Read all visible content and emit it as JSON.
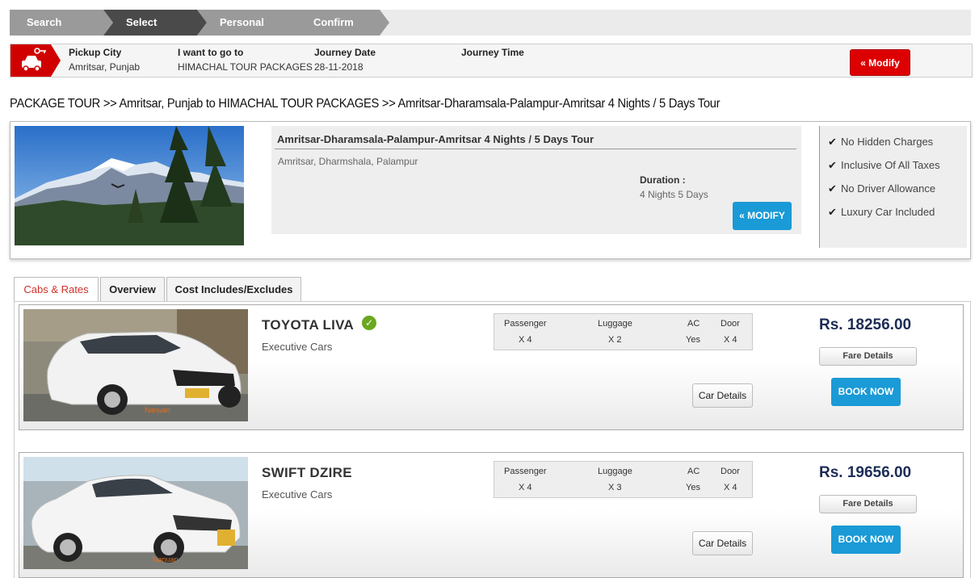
{
  "steps": [
    "Search",
    "Select",
    "Personal",
    "Confirm"
  ],
  "summary": {
    "pickup_label": "Pickup City",
    "pickup_value": "Amritsar, Punjab",
    "goto_label": "I want to go to",
    "goto_value": "HIMACHAL TOUR PACKAGES",
    "date_label": "Journey Date",
    "date_value": "28-11-2018",
    "time_label": "Journey Time",
    "modify_label": "« Modify"
  },
  "breadcrumb": "PACKAGE TOUR >> Amritsar, Punjab to HIMACHAL TOUR PACKAGES  >> Amritsar-Dharamsala-Palampur-Amritsar 4 Nights / 5 Days Tour",
  "package": {
    "title": "Amritsar-Dharamsala-Palampur-Amritsar 4 Nights / 5 Days Tour",
    "cities": "Amritsar, Dharmshala, Palampur",
    "duration_label": "Duration :",
    "duration_value": "4 Nights 5 Days",
    "modify_label": "« MODIFY",
    "features": [
      "No Hidden Charges",
      "Inclusive Of All Taxes",
      "No Driver Allowance",
      "Luxury Car Included"
    ]
  },
  "tabs": [
    "Cabs & Rates",
    "Overview",
    "Cost Includes/Excludes"
  ],
  "spec_labels": {
    "passenger": "Passenger",
    "luggage": "Luggage",
    "ac": "AC",
    "door": "Door"
  },
  "cars": [
    {
      "name": "TOYOTA LIVA",
      "class": "Executive Cars",
      "passenger": "X 4",
      "luggage": "X 2",
      "ac": "Yes",
      "door": "X 4",
      "price": "Rs. 18256.00",
      "fare_label": "Fare Details",
      "book_label": "BOOK NOW",
      "details_label": "Car Details"
    },
    {
      "name": "SWIFT DZIRE",
      "class": "Executive Cars",
      "passenger": "X 4",
      "luggage": "X 3",
      "ac": "Yes",
      "door": "X 4",
      "price": "Rs. 19656.00",
      "fare_label": "Fare Details",
      "book_label": "BOOK NOW",
      "details_label": "Car Details"
    }
  ],
  "colors": {
    "accent_red": "#d00000",
    "accent_blue": "#1a9ad6",
    "step_active": "#4a4a4a",
    "step_inactive": "#9a9a9a"
  }
}
